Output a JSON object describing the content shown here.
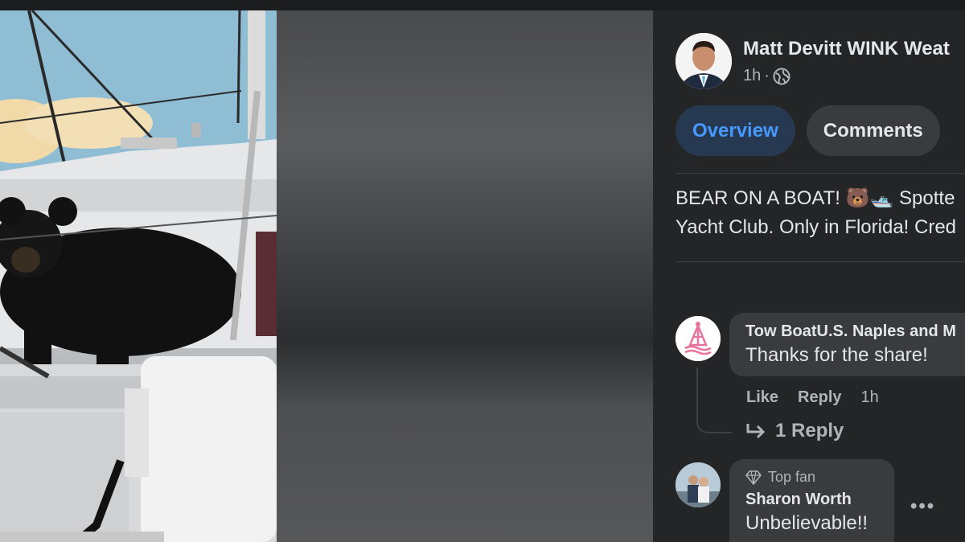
{
  "post": {
    "author": "Matt Devitt WINK Weat",
    "time": "1h",
    "separator": "·",
    "privacy_icon": "globe-icon",
    "caption_line1": "BEAR ON A BOAT! 🐻🛥️ Spotte",
    "caption_line2": "Yacht Club. Only in Florida! Cred"
  },
  "tabs": [
    {
      "label": "Overview",
      "active": true
    },
    {
      "label": "Comments",
      "active": false
    }
  ],
  "comments": [
    {
      "author": "Tow BoatU.S. Naples and M",
      "text": "Thanks for the share!",
      "like_label": "Like",
      "reply_label": "Reply",
      "time": "1h",
      "replies_label": "1 Reply"
    },
    {
      "badge": "Top fan",
      "author": "Sharon Worth",
      "text": "Unbelievable!!",
      "more_label": "•••"
    }
  ],
  "colors": {
    "panel_bg": "#242526",
    "bubble_bg": "#3a3b3c",
    "active_tab_bg": "#263951",
    "active_tab_text": "#4599ff",
    "brand_pink": "#e8739c"
  }
}
